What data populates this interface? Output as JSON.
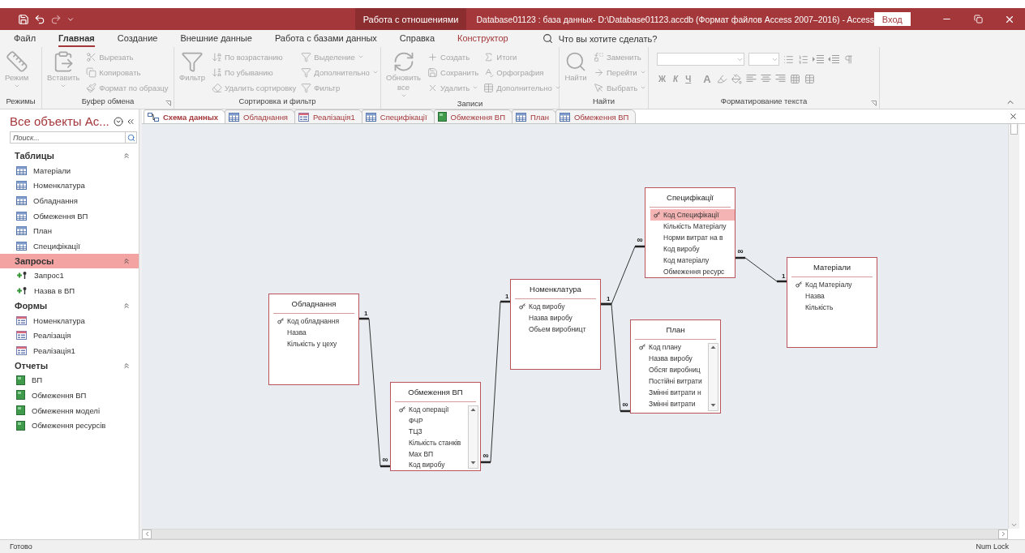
{
  "title_bar": {
    "context_tab": "Работа с отношениями",
    "title": "Database01123 : база данных- D:\\Database01123.accdb (Формат файлов Access 2007–2016)  -  Access",
    "sign_in": "Вход"
  },
  "ribbon_tabs": [
    {
      "label": "Файл",
      "selected": false,
      "kind": "normal"
    },
    {
      "label": "Главная",
      "selected": true,
      "kind": "normal"
    },
    {
      "label": "Создание",
      "selected": false,
      "kind": "normal"
    },
    {
      "label": "Внешние данные",
      "selected": false,
      "kind": "normal"
    },
    {
      "label": "Работа с базами данных",
      "selected": false,
      "kind": "normal"
    },
    {
      "label": "Справка",
      "selected": false,
      "kind": "normal"
    },
    {
      "label": "Конструктор",
      "selected": false,
      "kind": "contextual"
    }
  ],
  "tell_me": {
    "placeholder": "Что вы хотите сделать?"
  },
  "ribbon": {
    "disabled": true,
    "groups": [
      {
        "label": "Режимы",
        "kind": "commands",
        "launcher": false,
        "commands": [
          {
            "label": "Режим",
            "kind": "large",
            "dropdown": true
          }
        ]
      },
      {
        "label": "Буфер обмена",
        "kind": "commands",
        "launcher": true,
        "commands": [
          {
            "label": "Вставить",
            "kind": "large",
            "dropdown": true
          },
          {
            "label": "Вырезать",
            "kind": "small",
            "dropdown": false
          },
          {
            "label": "Копировать",
            "kind": "small",
            "dropdown": false
          },
          {
            "label": "Формат по образцу",
            "kind": "small",
            "dropdown": false
          }
        ]
      },
      {
        "label": "Сортировка и фильтр",
        "kind": "commands",
        "launcher": false,
        "commands": [
          {
            "label": "Фильтр",
            "kind": "large",
            "dropdown": false
          },
          {
            "label": "По возрастанию",
            "kind": "small",
            "dropdown": false
          },
          {
            "label": "По убыванию",
            "kind": "small",
            "dropdown": false
          },
          {
            "label": "Удалить сортировку",
            "kind": "small",
            "dropdown": false
          },
          {
            "label": "Выделение",
            "kind": "small",
            "dropdown": true
          },
          {
            "label": "Дополнительно",
            "kind": "small",
            "dropdown": true
          },
          {
            "label": "Фильтр",
            "kind": "small",
            "dropdown": false
          }
        ]
      },
      {
        "label": "Записи",
        "kind": "commands",
        "launcher": false,
        "commands": [
          {
            "label": "Обновить все",
            "kind": "large",
            "dropdown": true
          },
          {
            "label": "Создать",
            "kind": "small",
            "dropdown": false
          },
          {
            "label": "Сохранить",
            "kind": "small",
            "dropdown": false
          },
          {
            "label": "Удалить",
            "kind": "small",
            "dropdown": true
          },
          {
            "label": "Итоги",
            "kind": "small",
            "dropdown": false
          },
          {
            "label": "Орфография",
            "kind": "small",
            "dropdown": false
          },
          {
            "label": "Дополнительно",
            "kind": "small",
            "dropdown": true
          }
        ]
      },
      {
        "label": "Найти",
        "kind": "commands",
        "launcher": false,
        "commands": [
          {
            "label": "Найти",
            "kind": "large",
            "dropdown": false
          },
          {
            "label": "Заменить",
            "kind": "small",
            "dropdown": false
          },
          {
            "label": "Перейти",
            "kind": "small",
            "dropdown": true
          },
          {
            "label": "Выбрать",
            "kind": "small",
            "dropdown": true
          }
        ]
      },
      {
        "label": "Форматирование текста",
        "kind": "format",
        "launcher": true,
        "letters": [
          "Ж",
          "К",
          "Ч",
          "А"
        ]
      }
    ]
  },
  "navigation": {
    "title": "Все объекты Ac...",
    "search": {
      "placeholder": "Поиск..."
    },
    "sections": [
      {
        "label": "Таблицы",
        "kind": "table",
        "expanded": true,
        "selected": false,
        "items": [
          "Матеріали",
          "Номенклатура",
          "Обладнання",
          "Обмеження ВП",
          "План",
          "Специфікації"
        ]
      },
      {
        "label": "Запросы",
        "kind": "query",
        "expanded": true,
        "selected": true,
        "items": [
          "Запрос1",
          "Назва в ВП"
        ]
      },
      {
        "label": "Формы",
        "kind": "form",
        "expanded": true,
        "selected": false,
        "items": [
          "Номенклатура",
          "Реалізація",
          "Реалізація1"
        ]
      },
      {
        "label": "Отчеты",
        "kind": "report",
        "expanded": true,
        "selected": false,
        "items": [
          "ВП",
          "Обмеження ВП",
          "Обмеження моделі",
          "Обмеження ресурсів"
        ]
      }
    ]
  },
  "document_tabs": [
    {
      "label": "Схема данных",
      "kind": "relationships",
      "selected": true
    },
    {
      "label": "Обладнання",
      "kind": "table",
      "selected": false
    },
    {
      "label": "Реалізація1",
      "kind": "form",
      "selected": false
    },
    {
      "label": "Специфікації",
      "kind": "table",
      "selected": false
    },
    {
      "label": "Обмеження ВП",
      "kind": "report",
      "selected": false
    },
    {
      "label": "План",
      "kind": "table",
      "selected": false
    },
    {
      "label": "Обмеження ВП",
      "kind": "table",
      "selected": false
    }
  ],
  "diagram": {
    "tables": [
      {
        "title": "Обладнання",
        "scrollable": false,
        "fields": [
          {
            "name": "Код обладнання",
            "key": true,
            "selected": false
          },
          {
            "name": "Назва",
            "key": false,
            "selected": false
          },
          {
            "name": "Кількість у цеху",
            "key": false,
            "selected": false
          }
        ]
      },
      {
        "title": "Обмеження ВП",
        "scrollable": true,
        "fields": [
          {
            "name": "Код операції",
            "key": true,
            "selected": false
          },
          {
            "name": "ФЧР",
            "key": false,
            "selected": false
          },
          {
            "name": "ТЦЗ",
            "key": false,
            "selected": false
          },
          {
            "name": "Кількість станків",
            "key": false,
            "selected": false
          },
          {
            "name": "Max ВП",
            "key": false,
            "selected": false
          },
          {
            "name": "Код виробу",
            "key": false,
            "selected": false
          }
        ]
      },
      {
        "title": "Номенклатура",
        "scrollable": false,
        "fields": [
          {
            "name": "Код виробу",
            "key": true,
            "selected": false
          },
          {
            "name": "Назва виробу",
            "key": false,
            "selected": false
          },
          {
            "name": "Обьем виробницт",
            "key": false,
            "selected": false
          }
        ]
      },
      {
        "title": "Специфікації",
        "scrollable": false,
        "fields": [
          {
            "name": "Код Специфікації",
            "key": true,
            "selected": true
          },
          {
            "name": "Кількість Матеріалу",
            "key": false,
            "selected": false
          },
          {
            "name": "Норми витрат на в",
            "key": false,
            "selected": false
          },
          {
            "name": "Код виробу",
            "key": false,
            "selected": false
          },
          {
            "name": "Код матеріалу",
            "key": false,
            "selected": false
          },
          {
            "name": "Обмеження ресурс",
            "key": false,
            "selected": false
          }
        ]
      },
      {
        "title": "План",
        "scrollable": true,
        "fields": [
          {
            "name": "Код плану",
            "key": true,
            "selected": false
          },
          {
            "name": "Назва виробу",
            "key": false,
            "selected": false
          },
          {
            "name": "Обсяг виробниц",
            "key": false,
            "selected": false
          },
          {
            "name": "Постійні витрати",
            "key": false,
            "selected": false
          },
          {
            "name": "Змінні витрати н",
            "key": false,
            "selected": false
          },
          {
            "name": "Змінні витрати",
            "key": false,
            "selected": false
          }
        ]
      },
      {
        "title": "Матеріали",
        "scrollable": false,
        "fields": [
          {
            "name": "Код Матеріалу",
            "key": true,
            "selected": false
          },
          {
            "name": "Назва",
            "key": false,
            "selected": false
          },
          {
            "name": "Кількість",
            "key": false,
            "selected": false
          }
        ]
      }
    ],
    "relationships": [
      {
        "one": "1",
        "many": "∞"
      },
      {
        "one": "1",
        "many": "∞"
      },
      {
        "one": "1",
        "many": "∞"
      },
      {
        "many": "∞"
      },
      {
        "one": "1",
        "many": "∞"
      }
    ]
  },
  "status_bar": {
    "left": "Готово",
    "right": "Num Lock"
  }
}
